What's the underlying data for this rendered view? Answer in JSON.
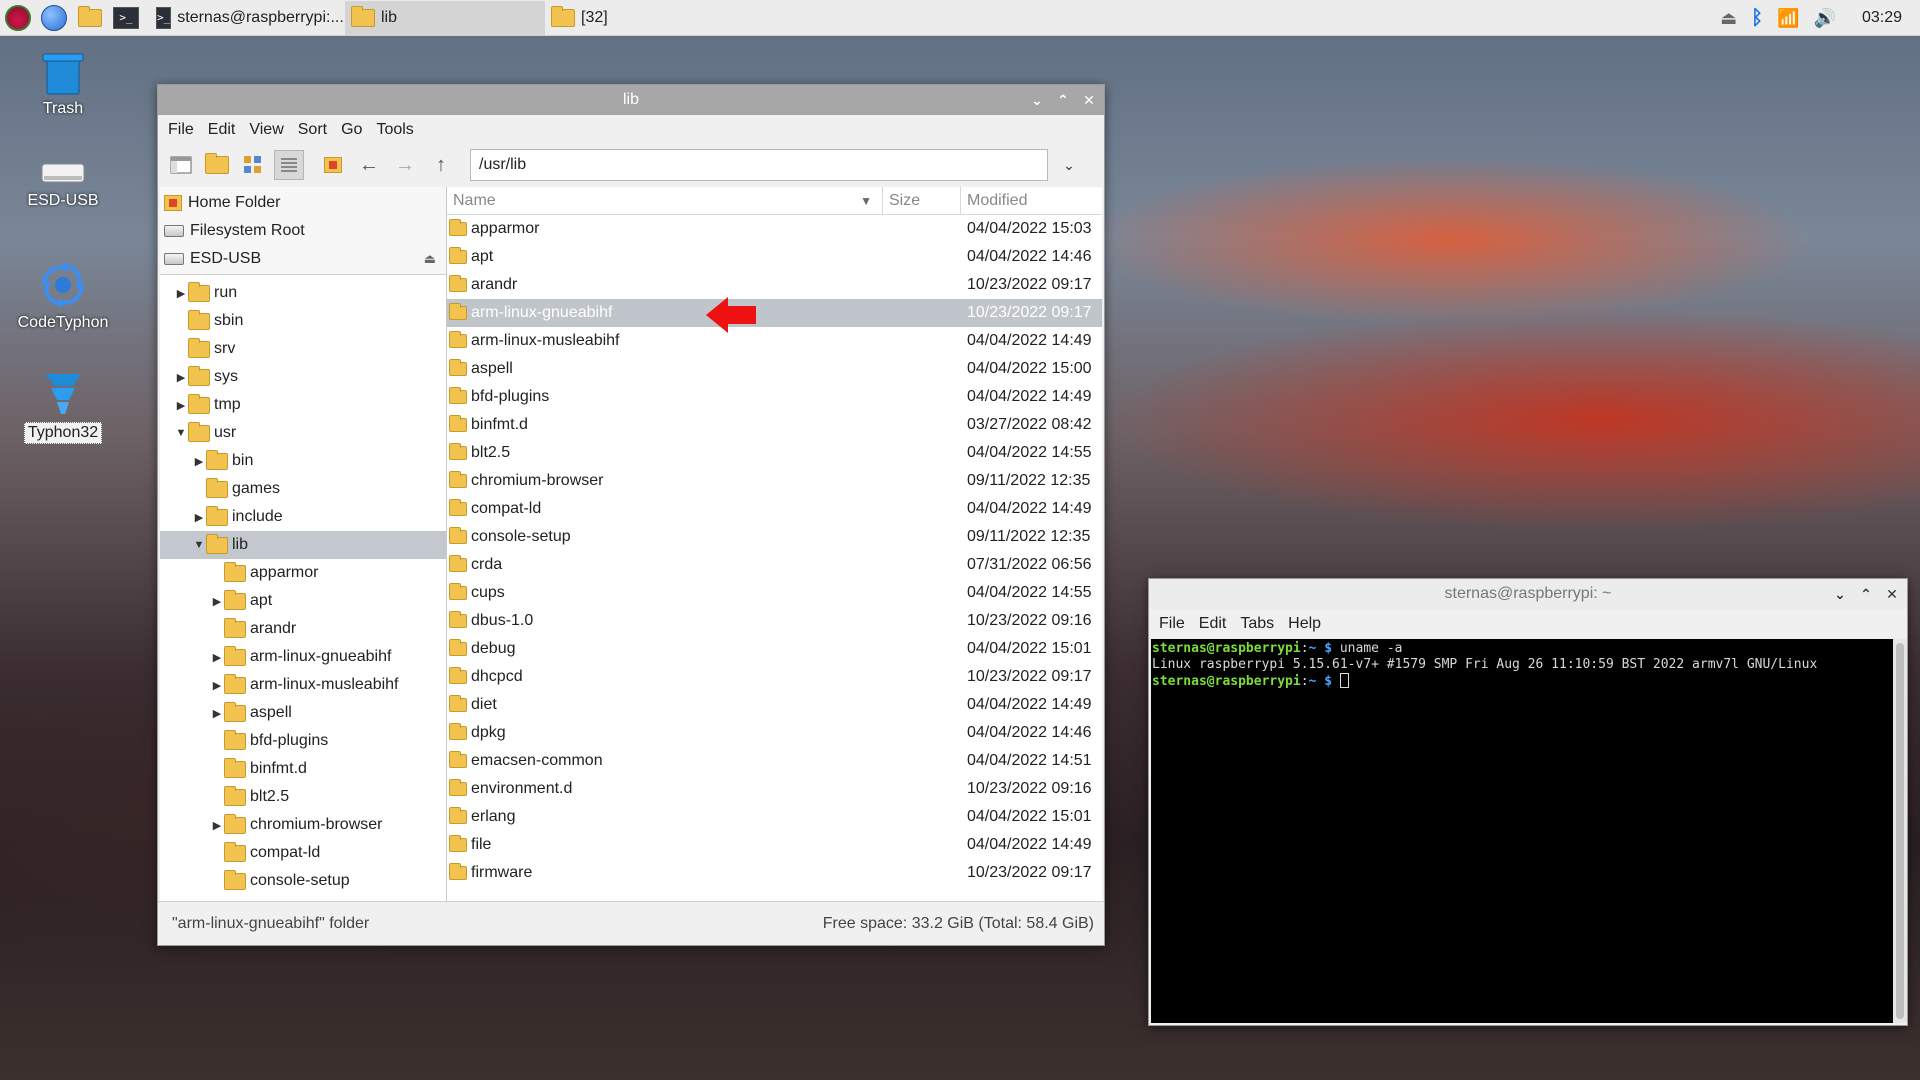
{
  "taskbar": {
    "tasks": [
      {
        "label": "sternas@raspberrypi:...",
        "icon": "terminal-icon"
      },
      {
        "label": "lib",
        "icon": "folder-icon"
      },
      {
        "label": "[32]",
        "icon": "folder-icon"
      }
    ],
    "clock": "03:29"
  },
  "desktop": {
    "icons": [
      {
        "label": "Trash",
        "icon": "trash-icon"
      },
      {
        "label": "ESD-USB",
        "icon": "drive-icon"
      },
      {
        "label": "CodeTyphon",
        "icon": "codetyphon-icon"
      },
      {
        "label": "Typhon32",
        "icon": "typhon32-icon"
      }
    ]
  },
  "file_manager": {
    "title": "lib",
    "menu": [
      "File",
      "Edit",
      "View",
      "Sort",
      "Go",
      "Tools"
    ],
    "path": "/usr/lib",
    "places": [
      "Home Folder",
      "Filesystem Root",
      "ESD-USB"
    ],
    "tree": [
      {
        "label": "run",
        "depth": 0,
        "expander": "collapsed"
      },
      {
        "label": "sbin",
        "depth": 0,
        "expander": "none"
      },
      {
        "label": "srv",
        "depth": 0,
        "expander": "none"
      },
      {
        "label": "sys",
        "depth": 0,
        "expander": "collapsed"
      },
      {
        "label": "tmp",
        "depth": 0,
        "expander": "collapsed"
      },
      {
        "label": "usr",
        "depth": 0,
        "expander": "expanded"
      },
      {
        "label": "bin",
        "depth": 1,
        "expander": "collapsed"
      },
      {
        "label": "games",
        "depth": 1,
        "expander": "none"
      },
      {
        "label": "include",
        "depth": 1,
        "expander": "collapsed"
      },
      {
        "label": "lib",
        "depth": 1,
        "expander": "expanded",
        "selected": true
      },
      {
        "label": "apparmor",
        "depth": 2,
        "expander": "none"
      },
      {
        "label": "apt",
        "depth": 2,
        "expander": "collapsed"
      },
      {
        "label": "arandr",
        "depth": 2,
        "expander": "none"
      },
      {
        "label": "arm-linux-gnueabihf",
        "depth": 2,
        "expander": "collapsed"
      },
      {
        "label": "arm-linux-musleabihf",
        "depth": 2,
        "expander": "collapsed"
      },
      {
        "label": "aspell",
        "depth": 2,
        "expander": "collapsed"
      },
      {
        "label": "bfd-plugins",
        "depth": 2,
        "expander": "none"
      },
      {
        "label": "binfmt.d",
        "depth": 2,
        "expander": "none"
      },
      {
        "label": "blt2.5",
        "depth": 2,
        "expander": "none"
      },
      {
        "label": "chromium-browser",
        "depth": 2,
        "expander": "collapsed"
      },
      {
        "label": "compat-ld",
        "depth": 2,
        "expander": "none"
      },
      {
        "label": "console-setup",
        "depth": 2,
        "expander": "none"
      }
    ],
    "columns": {
      "name": "Name",
      "size": "Size",
      "modified": "Modified"
    },
    "rows": [
      {
        "name": "apparmor",
        "modified": "04/04/2022 15:03"
      },
      {
        "name": "apt",
        "modified": "04/04/2022 14:46"
      },
      {
        "name": "arandr",
        "modified": "10/23/2022 09:17"
      },
      {
        "name": "arm-linux-gnueabihf",
        "modified": "10/23/2022 09:17",
        "selected": true
      },
      {
        "name": "arm-linux-musleabihf",
        "modified": "04/04/2022 14:49"
      },
      {
        "name": "aspell",
        "modified": "04/04/2022 15:00"
      },
      {
        "name": "bfd-plugins",
        "modified": "04/04/2022 14:49"
      },
      {
        "name": "binfmt.d",
        "modified": "03/27/2022 08:42"
      },
      {
        "name": "blt2.5",
        "modified": "04/04/2022 14:55"
      },
      {
        "name": "chromium-browser",
        "modified": "09/11/2022 12:35"
      },
      {
        "name": "compat-ld",
        "modified": "04/04/2022 14:49"
      },
      {
        "name": "console-setup",
        "modified": "09/11/2022 12:35"
      },
      {
        "name": "crda",
        "modified": "07/31/2022 06:56"
      },
      {
        "name": "cups",
        "modified": "04/04/2022 14:55"
      },
      {
        "name": "dbus-1.0",
        "modified": "10/23/2022 09:16"
      },
      {
        "name": "debug",
        "modified": "04/04/2022 15:01"
      },
      {
        "name": "dhcpcd",
        "modified": "10/23/2022 09:17"
      },
      {
        "name": "diet",
        "modified": "04/04/2022 14:49"
      },
      {
        "name": "dpkg",
        "modified": "04/04/2022 14:46"
      },
      {
        "name": "emacsen-common",
        "modified": "04/04/2022 14:51"
      },
      {
        "name": "environment.d",
        "modified": "10/23/2022 09:16"
      },
      {
        "name": "erlang",
        "modified": "04/04/2022 15:01"
      },
      {
        "name": "file",
        "modified": "04/04/2022 14:49"
      },
      {
        "name": "firmware",
        "modified": "10/23/2022 09:17"
      }
    ],
    "status_left": "\"arm-linux-gnueabihf\" folder",
    "status_right": "Free space: 33.2 GiB (Total: 58.4 GiB)"
  },
  "terminal": {
    "title": "sternas@raspberrypi: ~",
    "menu": [
      "File",
      "Edit",
      "Tabs",
      "Help"
    ],
    "prompt_user": "sternas@raspberrypi",
    "prompt_sep": ":",
    "prompt_path": "~",
    "prompt_symbol": " $ ",
    "command": "uname -a",
    "output": "Linux raspberrypi 5.15.61-v7+ #1579 SMP Fri Aug 26 11:10:59 BST 2022 armv7l GNU/Linux"
  },
  "colors": {
    "highlight_arrow": "#ee1111",
    "prompt_user": "#7cdd3a",
    "prompt_path": "#4aa3ff"
  }
}
